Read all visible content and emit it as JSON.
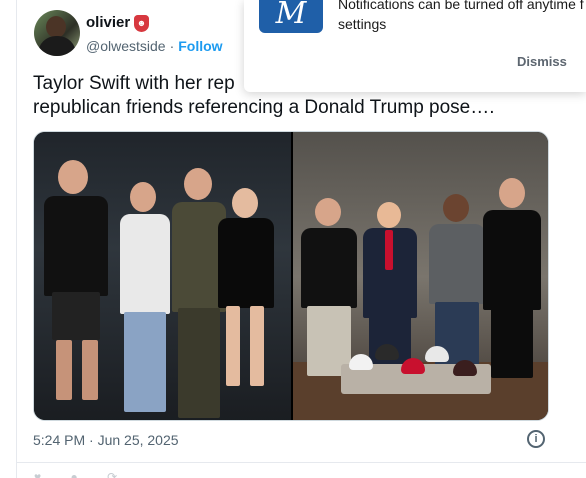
{
  "tweet": {
    "display_name": "olivier",
    "handle": "@olwestside",
    "separator": "·",
    "follow_label": "Follow",
    "text": "Taylor Swift with her rep… republican friends referencing a Donald Trump pose….",
    "text_line1": "Taylor Swift with her rep",
    "text_line2": "republican friends referencing a Donald Trump pose….",
    "timestamp": "5:24 PM · Jun 25, 2025",
    "info_icon": "i"
  },
  "popup": {
    "logo_text": "M",
    "message": "Notifications can be turned off anytime from settings",
    "message_line1": "Notifications can be turned off anytime f",
    "message_line2": "settings",
    "dismiss_label": "Dismiss"
  },
  "colors": {
    "link": "#1d9bf0",
    "secondary_text": "#536471",
    "logo_bg": "#1f5fa8"
  },
  "icons": [
    "avatar-icon",
    "emoji-icon",
    "info-icon",
    "brand-logo-icon"
  ]
}
